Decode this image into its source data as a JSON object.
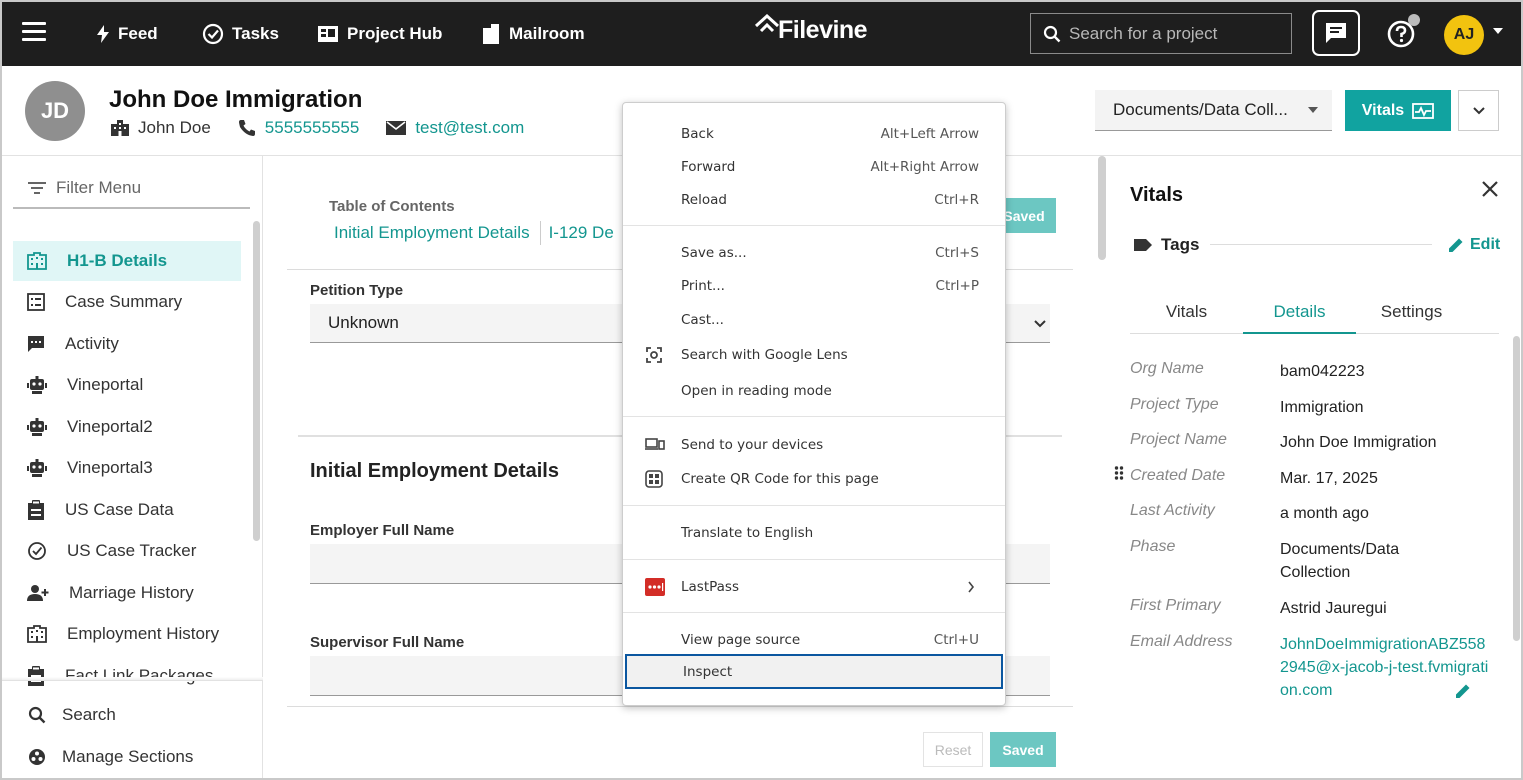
{
  "nav": {
    "feed": "Feed",
    "tasks": "Tasks",
    "project_hub": "Project Hub",
    "mailroom": "Mailroom",
    "brand": "Filevine",
    "search_placeholder": "Search for a project",
    "user_initials": "AJ"
  },
  "project": {
    "initials": "JD",
    "title": "John Doe Immigration",
    "client": "John Doe",
    "phone": "5555555555",
    "email": "test@test.com",
    "phase": "Documents/Data Coll...",
    "vitals_button": "Vitals"
  },
  "sidebar": {
    "filter": "Filter Menu",
    "items": [
      {
        "label": "H1-B Details",
        "icon": "building-icon",
        "active": true
      },
      {
        "label": "Case Summary",
        "icon": "list-box-icon"
      },
      {
        "label": "Activity",
        "icon": "chat-box-icon"
      },
      {
        "label": "Vineportal",
        "icon": "robot-icon"
      },
      {
        "label": "Vineportal2",
        "icon": "robot-icon"
      },
      {
        "label": "Vineportal3",
        "icon": "robot-icon"
      },
      {
        "label": "US Case Data",
        "icon": "clipboard-icon"
      },
      {
        "label": "US Case Tracker",
        "icon": "check-circle-icon"
      },
      {
        "label": "Marriage History",
        "icon": "people-icon"
      },
      {
        "label": "Employment History",
        "icon": "building-icon"
      },
      {
        "label": "Fact Link Packages",
        "icon": "clipboard-icon"
      }
    ],
    "search": "Search",
    "manage": "Manage Sections"
  },
  "main": {
    "toc_title": "Table of Contents",
    "toc_links": [
      "Initial Employment Details",
      "I-129 De"
    ],
    "saved_top": "Saved",
    "petition_label": "Petition Type",
    "petition_value": "Unknown",
    "section_title": "Initial Employment Details",
    "employer_label": "Employer Full Name",
    "supervisor_label": "Supervisor Full Name",
    "reset": "Reset",
    "saved": "Saved"
  },
  "vitals_panel": {
    "title": "Vitals",
    "tags": "Tags",
    "edit": "Edit",
    "tabs": [
      "Vitals",
      "Details",
      "Settings"
    ],
    "active_tab": "Details",
    "rows": [
      {
        "key": "Org Name",
        "value": "bam042223"
      },
      {
        "key": "Project Type",
        "value": "Immigration"
      },
      {
        "key": "Project Name",
        "value": "John Doe Immigration"
      },
      {
        "key": "Created Date",
        "value": "Mar. 17, 2025"
      },
      {
        "key": "Last Activity",
        "value": "a month ago"
      },
      {
        "key": "Phase",
        "value": "Documents/Data Collection"
      },
      {
        "key": "First Primary",
        "value": "Astrid Jauregui"
      },
      {
        "key": "Email Address",
        "value": "JohnDoeImmigrationABZ5582945@x-jacob-j-test.fvmigration.com"
      }
    ]
  },
  "context_menu": {
    "back": "Back",
    "back_sc": "Alt+Left Arrow",
    "forward": "Forward",
    "forward_sc": "Alt+Right Arrow",
    "reload": "Reload",
    "reload_sc": "Ctrl+R",
    "save_as": "Save as...",
    "save_as_sc": "Ctrl+S",
    "print": "Print...",
    "print_sc": "Ctrl+P",
    "cast": "Cast...",
    "lens": "Search with Google Lens",
    "reading": "Open in reading mode",
    "send": "Send to your devices",
    "qr": "Create QR Code for this page",
    "translate": "Translate to English",
    "lastpass": "LastPass",
    "source": "View page source",
    "source_sc": "Ctrl+U",
    "inspect": "Inspect"
  },
  "colors": {
    "accent": "#13968f",
    "nav_bg": "#1e1e1e",
    "avatar_yellow": "#f2c30f",
    "vitals_button": "#11a3a0",
    "focus_ring": "#0b57a0"
  }
}
